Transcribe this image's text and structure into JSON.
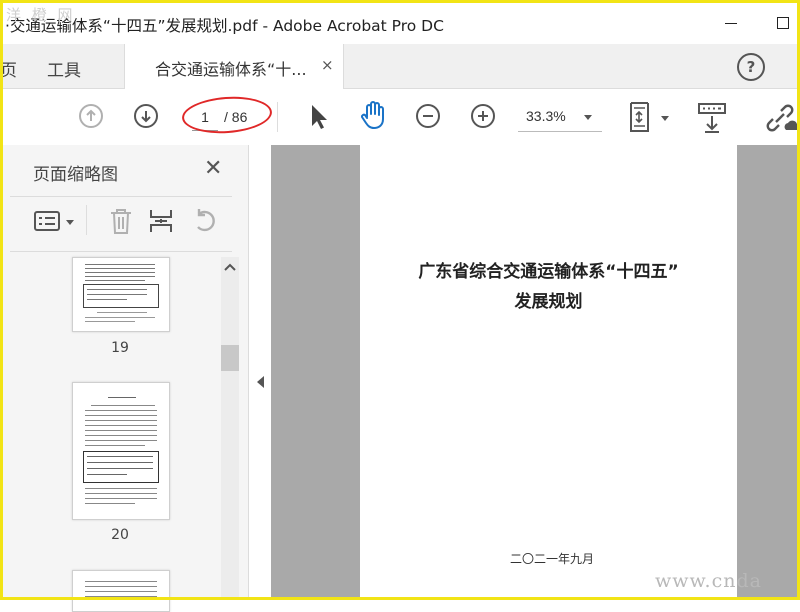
{
  "window": {
    "title": "·交通运输体系“十四五”发展规划.pdf - Adobe Acrobat Pro DC",
    "watermark_top": "洋 橙 网"
  },
  "tabs": {
    "home_fragment": "页",
    "tools": "工具",
    "document": "合交通运输体系“十...",
    "close_glyph": "×",
    "help_glyph": "?"
  },
  "toolbar": {
    "current_page": "1",
    "total_pages": "/ 86",
    "zoom": "33.3%"
  },
  "panel": {
    "title": "页面缩略图",
    "close_glyph": "✕",
    "thumbnails": [
      {
        "page": "19"
      },
      {
        "page": "20"
      }
    ]
  },
  "document": {
    "title_line1": "广东省综合交通运输体系“十四五”",
    "title_line2": "发展规划",
    "date": "二〇二一年九月"
  },
  "watermark_bottom": "www.cnda",
  "colors": {
    "frame": "#f2e415",
    "annotation": "#e02828",
    "hand_tool": "#1a73c7"
  }
}
